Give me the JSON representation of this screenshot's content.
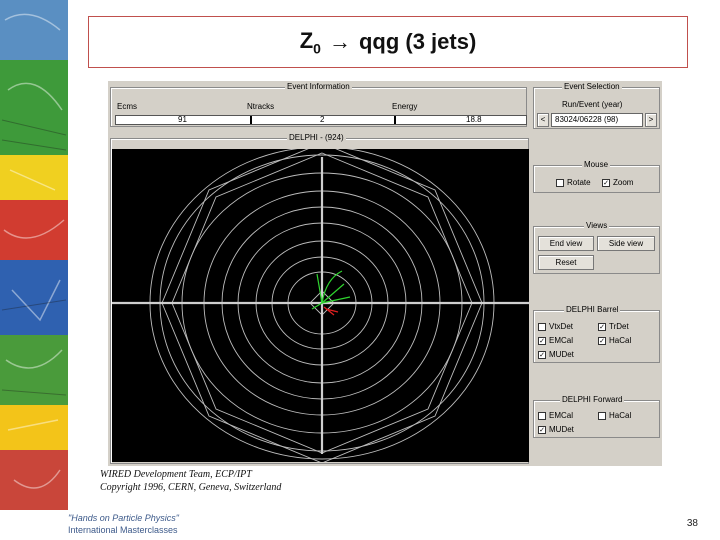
{
  "slide": {
    "title_main": "Z",
    "title_sub": "0",
    "title_arrow": "→",
    "title_rest": "qqg (3 jets)",
    "page_number": "38"
  },
  "app": {
    "event_info": {
      "title": "Event Information",
      "fields": [
        {
          "label": "Ecms",
          "value": "91"
        },
        {
          "label": "Ntracks",
          "value": "2"
        },
        {
          "label": "Energy",
          "value": "18.8"
        }
      ]
    },
    "display_title": "DELPHI - (924)",
    "event_selection": {
      "title": "Event Selection",
      "label": "Run/Event (year)",
      "prev": "<",
      "value": "83024/06228 (98)",
      "next": ">"
    },
    "mouse": {
      "title": "Mouse",
      "options": [
        {
          "label": "Rotate",
          "checked": false
        },
        {
          "label": "Zoom",
          "checked": true
        }
      ]
    },
    "views": {
      "title": "Views",
      "buttons": [
        "End view",
        "Side view",
        "Reset"
      ]
    },
    "barrel": {
      "title": "DELPHI Barrel",
      "options": [
        {
          "label": "VtxDet",
          "checked": false
        },
        {
          "label": "TrDet",
          "checked": true
        },
        {
          "label": "EMCal",
          "checked": true
        },
        {
          "label": "HaCal",
          "checked": true
        },
        {
          "label": "MUDet",
          "checked": true
        }
      ]
    },
    "forward": {
      "title": "DELPHI Forward",
      "options": [
        {
          "label": "EMCal",
          "checked": false
        },
        {
          "label": "HaCal",
          "checked": false
        },
        {
          "label": "MUDet",
          "checked": true
        }
      ]
    }
  },
  "credits": {
    "line1": "WIRED Development Team, ECP/IPT",
    "line2": "Copyright 1996, CERN, Geneva, Switzerland"
  },
  "logo": {
    "line1": "\"Hands on Particle Physics\"",
    "line2": "International Masterclasses"
  },
  "colors": {
    "title_border": "#c0504d",
    "panel_bg": "#d4d0c8",
    "display_bg": "#000000",
    "track_green": "#2fd42f",
    "track_red": "#e02020"
  }
}
